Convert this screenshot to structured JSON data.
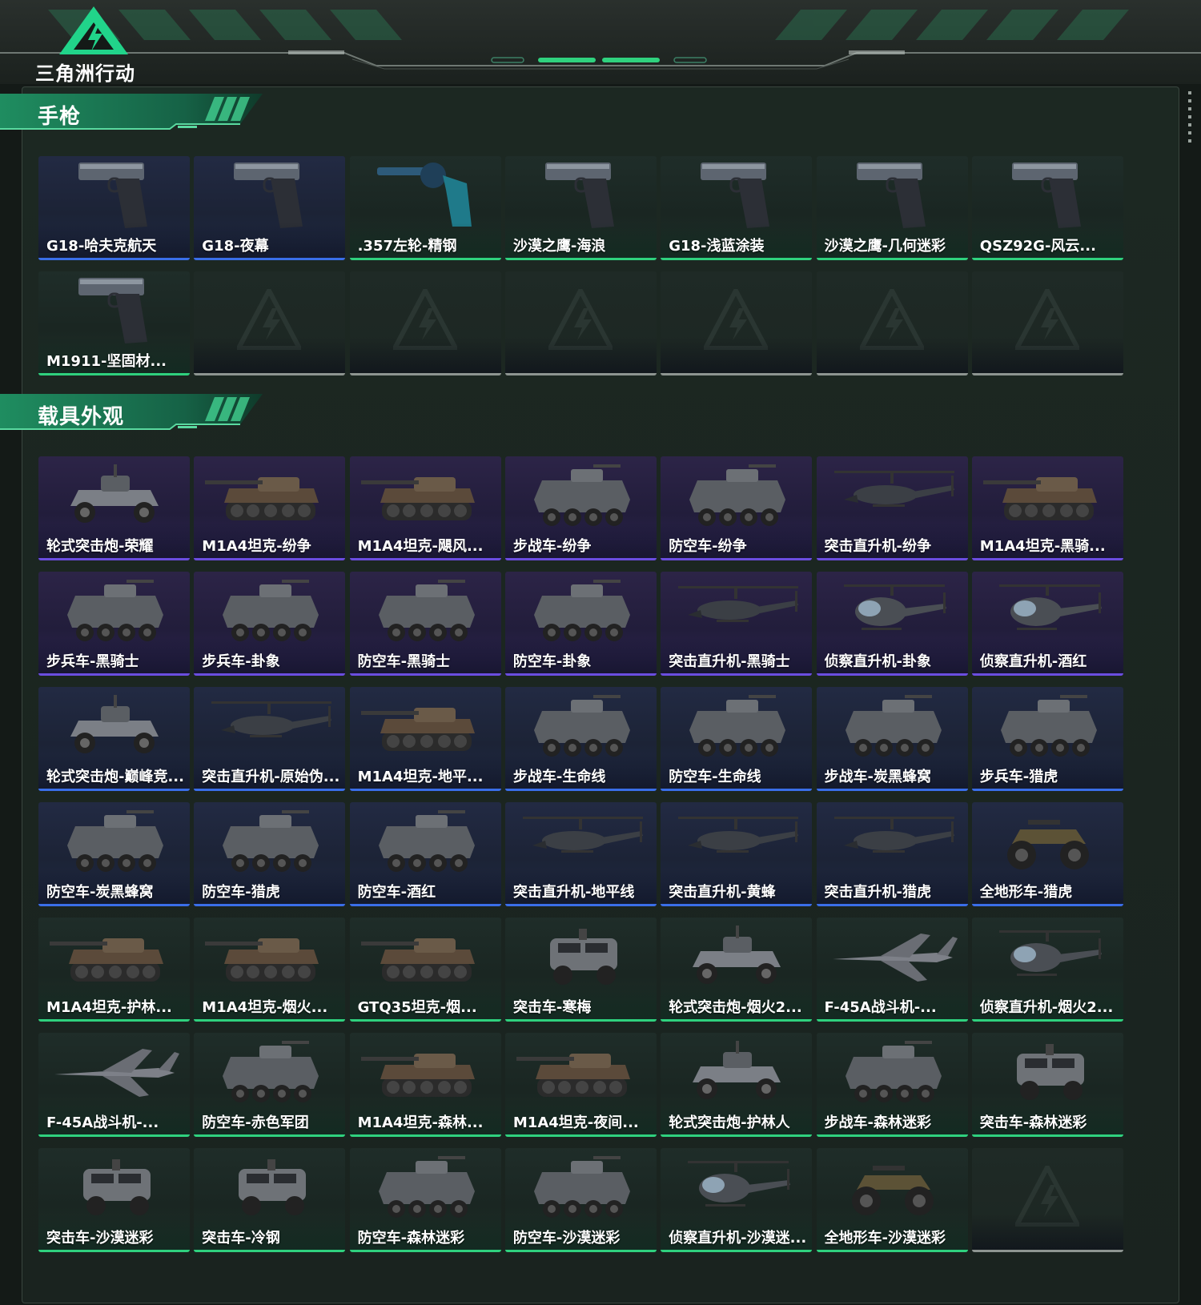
{
  "app": {
    "title": "三角洲行动"
  },
  "colors": {
    "accent": "#2fd17e",
    "quality_purple": "#6b4de0",
    "quality_blue": "#3a6ee8",
    "quality_green": "#2fd17e",
    "empty": "#8e9591",
    "panel_bg": "#1c2822"
  },
  "sections": [
    {
      "title": "手枪",
      "items": [
        {
          "label": "G18-哈夫克航天",
          "quality": "blue",
          "icon": "pistol"
        },
        {
          "label": "G18-夜幕",
          "quality": "blue",
          "icon": "pistol"
        },
        {
          "label": ".357左轮-精钢",
          "quality": "green",
          "icon": "revolver"
        },
        {
          "label": "沙漠之鹰-海浪",
          "quality": "green",
          "icon": "pistol"
        },
        {
          "label": "G18-浅蓝涂装",
          "quality": "green",
          "icon": "pistol"
        },
        {
          "label": "沙漠之鹰-几何迷彩",
          "quality": "green",
          "icon": "pistol"
        },
        {
          "label": "QSZ92G-风云...",
          "quality": "green",
          "icon": "pistol"
        },
        {
          "label": "M1911-坚固材...",
          "quality": "green",
          "icon": "pistol"
        },
        {
          "label": "",
          "quality": "empty",
          "icon": "empty"
        },
        {
          "label": "",
          "quality": "empty",
          "icon": "empty"
        },
        {
          "label": "",
          "quality": "empty",
          "icon": "empty"
        },
        {
          "label": "",
          "quality": "empty",
          "icon": "empty"
        },
        {
          "label": "",
          "quality": "empty",
          "icon": "empty"
        },
        {
          "label": "",
          "quality": "empty",
          "icon": "empty"
        }
      ]
    },
    {
      "title": "载具外观",
      "items": [
        {
          "label": "轮式突击炮-荣耀",
          "quality": "purple",
          "icon": "buggy"
        },
        {
          "label": "M1A4坦克-纷争",
          "quality": "purple",
          "icon": "tank"
        },
        {
          "label": "M1A4坦克-飓风...",
          "quality": "purple",
          "icon": "tank"
        },
        {
          "label": "步战车-纷争",
          "quality": "purple",
          "icon": "apc"
        },
        {
          "label": "防空车-纷争",
          "quality": "purple",
          "icon": "apc"
        },
        {
          "label": "突击直升机-纷争",
          "quality": "purple",
          "icon": "heli"
        },
        {
          "label": "M1A4坦克-黑骑...",
          "quality": "purple",
          "icon": "tank"
        },
        {
          "label": "步兵车-黑骑士",
          "quality": "purple",
          "icon": "apc"
        },
        {
          "label": "步兵车-卦象",
          "quality": "purple",
          "icon": "apc"
        },
        {
          "label": "防空车-黑骑士",
          "quality": "purple",
          "icon": "apc"
        },
        {
          "label": "防空车-卦象",
          "quality": "purple",
          "icon": "apc"
        },
        {
          "label": "突击直升机-黑骑士",
          "quality": "purple",
          "icon": "heli"
        },
        {
          "label": "侦察直升机-卦象",
          "quality": "purple",
          "icon": "scout"
        },
        {
          "label": "侦察直升机-酒红",
          "quality": "purple",
          "icon": "scout"
        },
        {
          "label": "轮式突击炮-巅峰竞...",
          "quality": "blue",
          "icon": "buggy"
        },
        {
          "label": "突击直升机-原始伪...",
          "quality": "blue",
          "icon": "heli"
        },
        {
          "label": "M1A4坦克-地平...",
          "quality": "blue",
          "icon": "tank"
        },
        {
          "label": "步战车-生命线",
          "quality": "blue",
          "icon": "apc"
        },
        {
          "label": "防空车-生命线",
          "quality": "blue",
          "icon": "apc"
        },
        {
          "label": "步战车-炭黑蜂窝",
          "quality": "blue",
          "icon": "apc"
        },
        {
          "label": "步兵车-猎虎",
          "quality": "blue",
          "icon": "apc"
        },
        {
          "label": "防空车-炭黑蜂窝",
          "quality": "blue",
          "icon": "apc"
        },
        {
          "label": "防空车-猎虎",
          "quality": "blue",
          "icon": "apc"
        },
        {
          "label": "防空车-酒红",
          "quality": "blue",
          "icon": "apc"
        },
        {
          "label": "突击直升机-地平线",
          "quality": "blue",
          "icon": "heli"
        },
        {
          "label": "突击直升机-黄蜂",
          "quality": "blue",
          "icon": "heli"
        },
        {
          "label": "突击直升机-猎虎",
          "quality": "blue",
          "icon": "heli"
        },
        {
          "label": "全地形车-猎虎",
          "quality": "blue",
          "icon": "atv"
        },
        {
          "label": "M1A4坦克-护林...",
          "quality": "green",
          "icon": "tank"
        },
        {
          "label": "M1A4坦克-烟火...",
          "quality": "green",
          "icon": "tank"
        },
        {
          "label": "GTQ35坦克-烟...",
          "quality": "green",
          "icon": "tank"
        },
        {
          "label": "突击车-寒梅",
          "quality": "green",
          "icon": "truck"
        },
        {
          "label": "轮式突击炮-烟火2...",
          "quality": "green",
          "icon": "buggy"
        },
        {
          "label": "F-45A战斗机-...",
          "quality": "green",
          "icon": "jet"
        },
        {
          "label": "侦察直升机-烟火2...",
          "quality": "green",
          "icon": "scout"
        },
        {
          "label": "F-45A战斗机-...",
          "quality": "green",
          "icon": "jet"
        },
        {
          "label": "防空车-赤色军团",
          "quality": "green",
          "icon": "apc"
        },
        {
          "label": "M1A4坦克-森林...",
          "quality": "green",
          "icon": "tank"
        },
        {
          "label": "M1A4坦克-夜间...",
          "quality": "green",
          "icon": "tank"
        },
        {
          "label": "轮式突击炮-护林人",
          "quality": "green",
          "icon": "buggy"
        },
        {
          "label": "步战车-森林迷彩",
          "quality": "green",
          "icon": "apc"
        },
        {
          "label": "突击车-森林迷彩",
          "quality": "green",
          "icon": "truck"
        },
        {
          "label": "突击车-沙漠迷彩",
          "quality": "green",
          "icon": "truck"
        },
        {
          "label": "突击车-冷钢",
          "quality": "green",
          "icon": "truck"
        },
        {
          "label": "防空车-森林迷彩",
          "quality": "green",
          "icon": "apc"
        },
        {
          "label": "防空车-沙漠迷彩",
          "quality": "green",
          "icon": "apc"
        },
        {
          "label": "侦察直升机-沙漠迷...",
          "quality": "green",
          "icon": "scout"
        },
        {
          "label": "全地形车-沙漠迷彩",
          "quality": "green",
          "icon": "atv"
        },
        {
          "label": "",
          "quality": "empty",
          "icon": "empty"
        }
      ]
    }
  ]
}
